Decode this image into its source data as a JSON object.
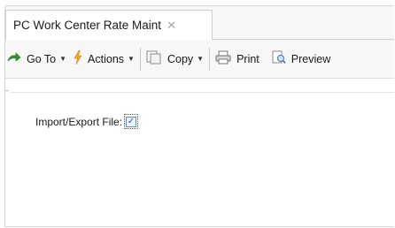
{
  "tab": {
    "title": "PC Work Center Rate Maint",
    "close_glyph": "✕"
  },
  "toolbar": {
    "goto_label": "Go To",
    "actions_label": "Actions",
    "copy_label": "Copy",
    "print_label": "Print",
    "preview_label": "Preview",
    "icons": [
      "arrow-goto-icon",
      "lightning-actions-icon",
      "copy-icon",
      "printer-icon",
      "preview-icon"
    ]
  },
  "form": {
    "import_export_label": "Import/Export File:",
    "import_export_checked": true
  }
}
